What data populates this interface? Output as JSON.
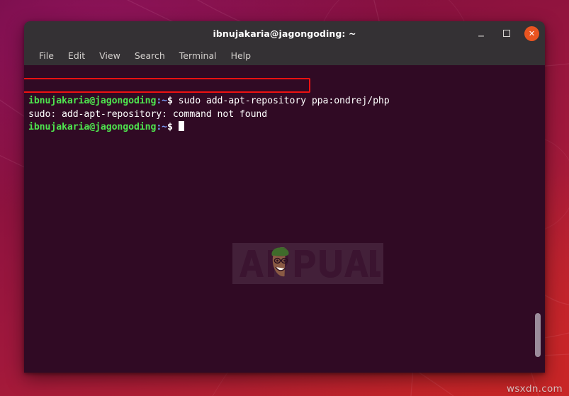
{
  "desktop": {
    "wallpaper_name": "ubuntu-purple-gradient",
    "colors": {
      "wallpaper_top": "#6d0a40",
      "wallpaper_bottom": "#c12323",
      "terminal_bg": "#300a24",
      "titlebar_bg": "#343134",
      "close_button": "#e95420",
      "prompt_user": "#4ee44e",
      "prompt_path": "#7b9bf5",
      "annotation_red": "#ee1111"
    }
  },
  "terminal": {
    "title": "ibnujakaria@jagongoding: ~",
    "controls": {
      "minimize": "—",
      "maximize": "",
      "close": "✕"
    },
    "menu": [
      {
        "label": "File"
      },
      {
        "label": "Edit"
      },
      {
        "label": "View"
      },
      {
        "label": "Search"
      },
      {
        "label": "Terminal"
      },
      {
        "label": "Help"
      }
    ],
    "lines": [
      {
        "type": "prompt",
        "user_host": "ibnujakaria@jagongoding",
        "path": ":~",
        "dollar": "$",
        "command": " sudo add-apt-repository ppa:ondrej/php"
      },
      {
        "type": "output",
        "text": "sudo: add-apt-repository: command not found"
      },
      {
        "type": "prompt",
        "user_host": "ibnujakaria@jagongoding",
        "path": ":~",
        "dollar": "$",
        "command": " "
      }
    ],
    "annotation": {
      "target_text": "sudo: add-apt-repository: command not found",
      "shape": "rectangle"
    }
  },
  "watermarks": {
    "logo_text": "APPUALS",
    "logo_icon": "appuals-mascot-icon",
    "site": "wsxdn.com"
  }
}
